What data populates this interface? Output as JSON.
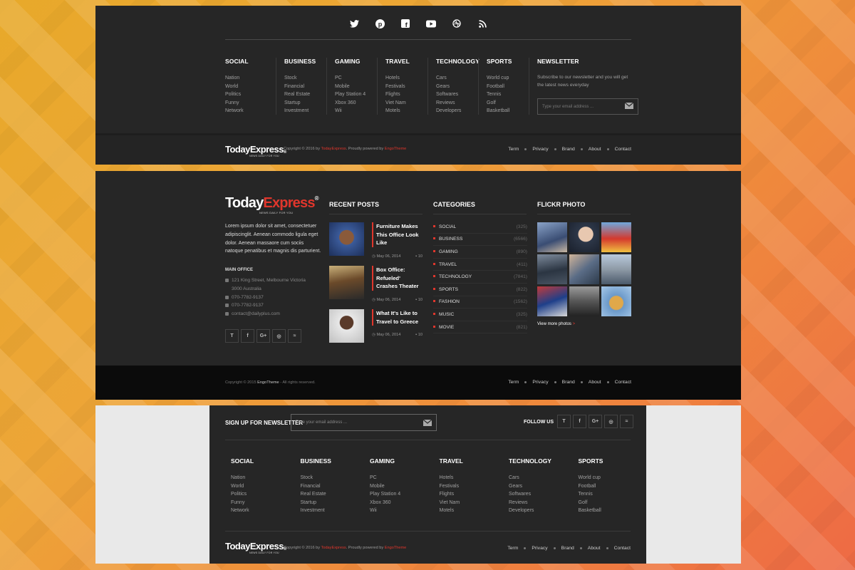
{
  "brand": {
    "logo_today": "Today",
    "logo_express": "Express",
    "logo_mark": "®",
    "tagline": "NEWS DAILY FOR YOU"
  },
  "top_social_icons": [
    "twitter-icon",
    "pinterest-icon",
    "facebook-icon",
    "youtube-icon",
    "dribbble-icon",
    "rss-icon"
  ],
  "top_footer": {
    "columns": [
      {
        "title": "SOCIAL",
        "items": [
          "Nation",
          "World",
          "Politics",
          "Funny",
          "Network"
        ]
      },
      {
        "title": "BUSINESS",
        "items": [
          "Stock",
          "Financial",
          "Real Estate",
          "Startup",
          "Investment"
        ]
      },
      {
        "title": "GAMING",
        "items": [
          "PC",
          "Mobile",
          "Play Station 4",
          "Xbox 360",
          "Wii"
        ]
      },
      {
        "title": "TRAVEL",
        "items": [
          "Hotels",
          "Festivals",
          "Flights",
          "Viet Nam",
          "Motels"
        ]
      },
      {
        "title": "TECHNOLOGY",
        "items": [
          "Cars",
          "Gears",
          "Softwares",
          "Reviews",
          "Developers"
        ]
      },
      {
        "title": "SPORTS",
        "items": [
          "World cup",
          "Football",
          "Tennis",
          "Golf",
          "Basketball"
        ]
      }
    ],
    "newsletter": {
      "title": "NEWSLETTER",
      "text": "Subscribe to our newsletter and you will get the latest news everyday",
      "placeholder": "Type your email address ..."
    },
    "copyright_prefix": "Copyright © 2016 by ",
    "copyright_brand": "TodayExpress",
    "copyright_mid": ". Proudly powered by ",
    "copyright_engo": "EngoTheme",
    "nav": [
      "Term",
      "Privacy",
      "Brand",
      "About",
      "Contact"
    ]
  },
  "middle_footer": {
    "about": "Lorem ipsum dolor sit amet, consectetuer adipiscinglit. Aenean commodo ligula eget dolor. Aenean massaore cum sociis natoque penatibus et magnis dis parturient.",
    "main_office": "MAIN OFFICE",
    "address": "121 King Street, Melbourne Victoria 3000 Australia",
    "phone1": "070-7782-9137",
    "phone2": "070-7782-9137",
    "email": "contact@dailyplus.com",
    "social": [
      "T",
      "f",
      "G+",
      "◎",
      "≈"
    ],
    "recent_title": "RECENT POSTS",
    "posts": [
      {
        "title": "Furniture Makes This Office Look Like",
        "date": "May 06, 2014",
        "comments": "10"
      },
      {
        "title": "Box Office: Refueled' Crashes Theater",
        "date": "May 06, 2014",
        "comments": "10"
      },
      {
        "title": "What It's Like to Travel to Greece",
        "date": "May 06, 2014",
        "comments": "10"
      }
    ],
    "cat_title": "CATEGORIES",
    "categories": [
      {
        "name": "SOCIAL",
        "count": "(325)"
      },
      {
        "name": "BUSINESS",
        "count": "(6566)"
      },
      {
        "name": "GAMING",
        "count": "(890)"
      },
      {
        "name": "TRAVEL",
        "count": "(411)"
      },
      {
        "name": "TECHNOLOGY",
        "count": "(7841)"
      },
      {
        "name": "SPORTS",
        "count": "(822)"
      },
      {
        "name": "FASHION",
        "count": "(1562)"
      },
      {
        "name": "MUSIC",
        "count": "(325)"
      },
      {
        "name": "MOVIE",
        "count": "(821)"
      }
    ],
    "flickr_title": "FLICKR PHOTO",
    "view_more": "View more photos",
    "view_more_arrow": ">",
    "copyright_prefix": "Copyright © 2015 ",
    "copyright_brand": "EngoTheme",
    "copyright_suffix": " - All rights reserved.",
    "nav": [
      "Term",
      "Privacy",
      "Brand",
      "About",
      "Contact"
    ]
  },
  "bottom_footer": {
    "signup": "SIGN UP FOR NEWSLETTER",
    "placeholder": "Type your email address ...",
    "follow": "FOLLOW US",
    "social": [
      "T",
      "f",
      "G+",
      "◎",
      "≈"
    ],
    "columns": [
      {
        "title": "SOCIAL",
        "items": [
          "Nation",
          "World",
          "Politics",
          "Funny",
          "Network"
        ]
      },
      {
        "title": "BUSINESS",
        "items": [
          "Stock",
          "Financial",
          "Real Estate",
          "Startup",
          "Investment"
        ]
      },
      {
        "title": "GAMING",
        "items": [
          "PC",
          "Mobile",
          "Play Station 4",
          "Xbox 360",
          "Wii"
        ]
      },
      {
        "title": "TRAVEL",
        "items": [
          "Hotels",
          "Festivals",
          "Flights",
          "Viet Nam",
          "Motels"
        ]
      },
      {
        "title": "TECHNOLOGY",
        "items": [
          "Cars",
          "Gears",
          "Softwares",
          "Reviews",
          "Developers"
        ]
      },
      {
        "title": "SPORTS",
        "items": [
          "World cup",
          "Football",
          "Tennis",
          "Golf",
          "Basketball"
        ]
      }
    ],
    "copyright_prefix": "Copyright © 2016 by ",
    "copyright_brand": "TodayExpress",
    "copyright_mid": ". Proudly powered by ",
    "copyright_engo": "EngoTheme",
    "nav": [
      "Term",
      "Privacy",
      "Brand",
      "About",
      "Contact"
    ]
  },
  "colors": {
    "accent": "#e0362c",
    "panel": "#262626"
  }
}
